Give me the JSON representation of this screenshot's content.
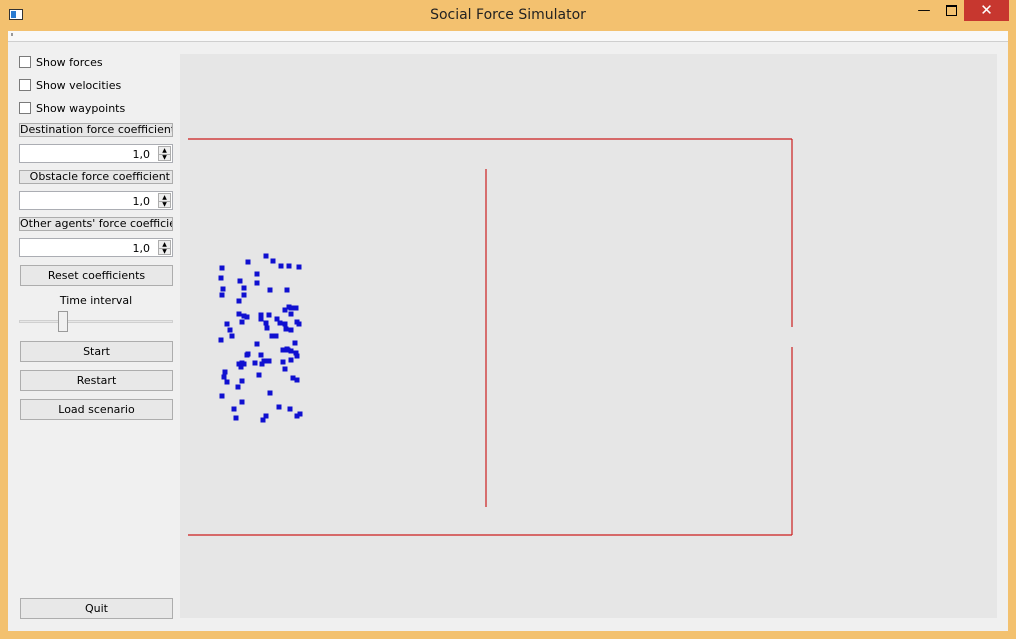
{
  "window": {
    "title": "Social Force Simulator",
    "minimize": "—",
    "close": "✕"
  },
  "controls": {
    "show_forces": "Show forces",
    "show_velocities": "Show velocities",
    "show_waypoints": "Show waypoints",
    "destination_force": {
      "label": "Destination force coefficient",
      "value": "1,0"
    },
    "obstacle_force": {
      "label": "Obstacle force coefficient",
      "value": "1,0"
    },
    "other_agents_force": {
      "label": "Other agents' force coefficient",
      "value": "1,0"
    },
    "reset_label": "Reset coefficients",
    "time_interval_label": "Time interval",
    "time_interval_fraction": 0.27,
    "start_label": "Start",
    "restart_label": "Restart",
    "load_label": "Load scenario",
    "quit_label": "Quit"
  },
  "colors": {
    "wall": "#cc1f1f",
    "agent": "#1010d0",
    "canvas_bg": "#e6e6e6",
    "title_bar": "#f3c16f",
    "close_button": "#c7372f"
  },
  "icons": {
    "app": "app-window-icon",
    "minimize": "minimize-icon",
    "maximize": "maximize-icon",
    "close": "close-icon",
    "spin_up": "arrow-up-icon",
    "spin_down": "arrow-down-icon"
  }
}
